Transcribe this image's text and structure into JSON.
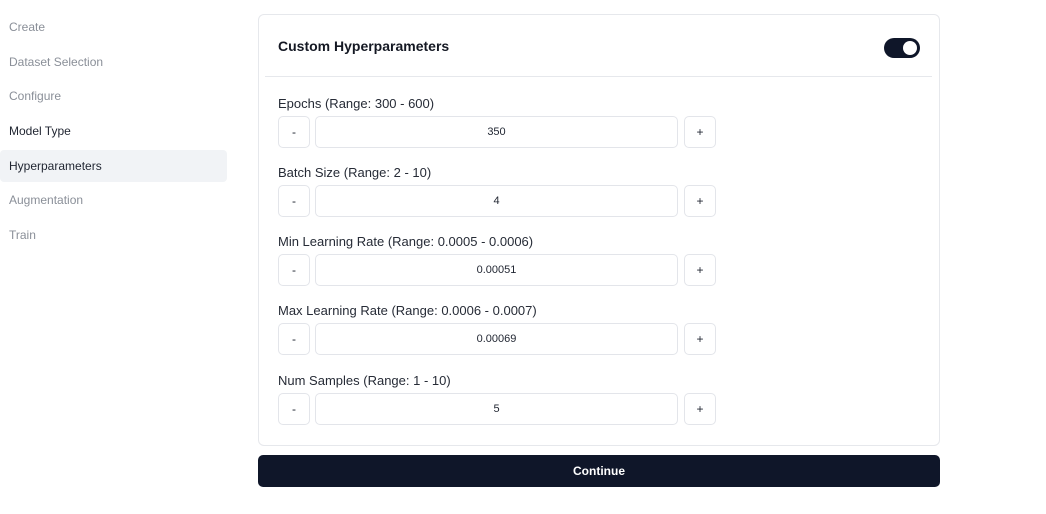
{
  "sidebar": {
    "items": [
      {
        "label": "Create"
      },
      {
        "label": "Dataset Selection"
      },
      {
        "label": "Configure"
      },
      {
        "label": "Model Type"
      },
      {
        "label": "Hyperparameters"
      },
      {
        "label": "Augmentation"
      },
      {
        "label": "Train"
      }
    ],
    "active": "Hyperparameters"
  },
  "card": {
    "title": "Custom Hyperparameters",
    "toggle_on": true
  },
  "fields": [
    {
      "label": "Epochs (Range: 300 - 600)",
      "value": "350"
    },
    {
      "label": "Batch Size (Range: 2 - 10)",
      "value": "4"
    },
    {
      "label": "Min Learning Rate (Range: 0.0005 - 0.0006)",
      "value": "0.00051"
    },
    {
      "label": "Max Learning Rate (Range: 0.0006 - 0.0007)",
      "value": "0.00069"
    },
    {
      "label": "Num Samples (Range: 1 - 10)",
      "value": "5"
    }
  ],
  "stepper": {
    "minus_label": "-",
    "plus_label": "+"
  },
  "continue_label": "Continue",
  "colors": {
    "primary": "#0f1629",
    "active_bg": "#f1f3f6",
    "muted": "#8a8f98"
  }
}
